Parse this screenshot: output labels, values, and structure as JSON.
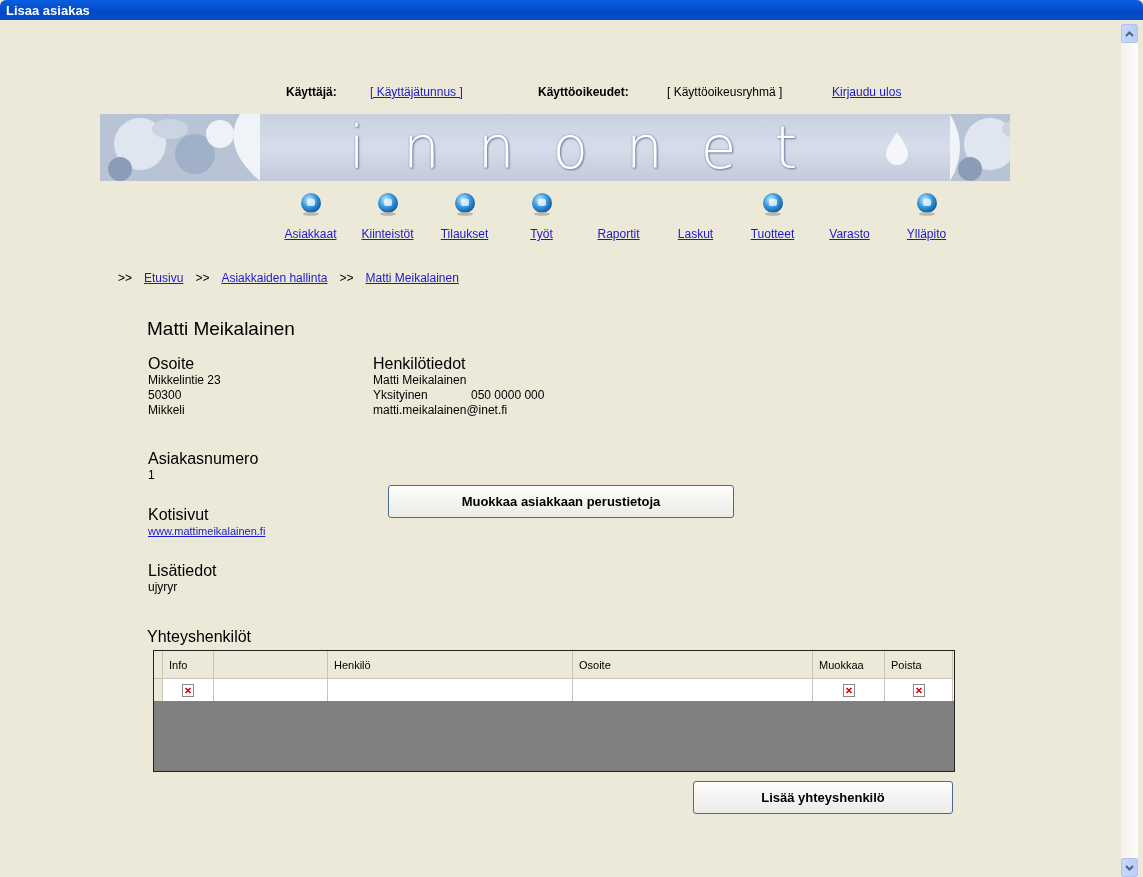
{
  "window": {
    "title": "Lisaa asiakas"
  },
  "user_bar": {
    "user_label": "Käyttäjä:",
    "user_link": "[ Käyttäjätunnus ]",
    "rights_label": "Käyttöoikeudet:",
    "rights_value": "[ Käyttöoikeusryhmä ]",
    "logout": "Kirjaudu ulos"
  },
  "banner": {
    "logo_text": "innonet"
  },
  "nav": [
    {
      "label": "Asiakkaat",
      "has_icon": true
    },
    {
      "label": "Kiinteistöt",
      "has_icon": true
    },
    {
      "label": "Tilaukset",
      "has_icon": true
    },
    {
      "label": "Työt",
      "has_icon": true
    },
    {
      "label": "Raportit",
      "has_icon": false
    },
    {
      "label": "Laskut",
      "has_icon": false
    },
    {
      "label": "Tuotteet",
      "has_icon": true
    },
    {
      "label": "Varasto",
      "has_icon": false
    },
    {
      "label": "Ylläpito",
      "has_icon": true
    }
  ],
  "breadcrumb": {
    "separator": ">>",
    "items": [
      "Etusivu",
      "Asiakkaiden hallinta",
      "Matti Meikalainen"
    ]
  },
  "customer": {
    "name": "Matti Meikalainen",
    "address": {
      "title": "Osoite",
      "lines": [
        "Mikkelintie 23",
        "50300",
        "Mikkeli"
      ]
    },
    "person": {
      "title": "Henkilötiedot",
      "name": "Matti Meikalainen",
      "type": "Yksityinen",
      "phone": "050 0000 000",
      "email": "matti.meikalainen@inet.fi"
    },
    "number": {
      "title": "Asiakasnumero",
      "value": "1"
    },
    "homepage": {
      "title": "Kotisivut",
      "link": "www.mattimeikalainen.fi"
    },
    "extra": {
      "title": "Lisätiedot",
      "value": "ujyryr"
    },
    "edit_button": "Muokkaa asiakkaan perustietoja"
  },
  "contacts": {
    "title": "Yhteyshenkilöt",
    "columns": [
      {
        "label": "Info",
        "kind": "icon"
      },
      {
        "kind": "text"
      },
      {
        "label": "Henkilö",
        "kind": "text"
      },
      {
        "label": "Osoite",
        "kind": "text"
      },
      {
        "label": "Muokkaa",
        "kind": "icon"
      },
      {
        "label": "Poista",
        "kind": "icon"
      }
    ],
    "rows": [
      {
        "kind": "placeholder"
      }
    ],
    "add_button": "Lisää yhteyshenkilö"
  }
}
